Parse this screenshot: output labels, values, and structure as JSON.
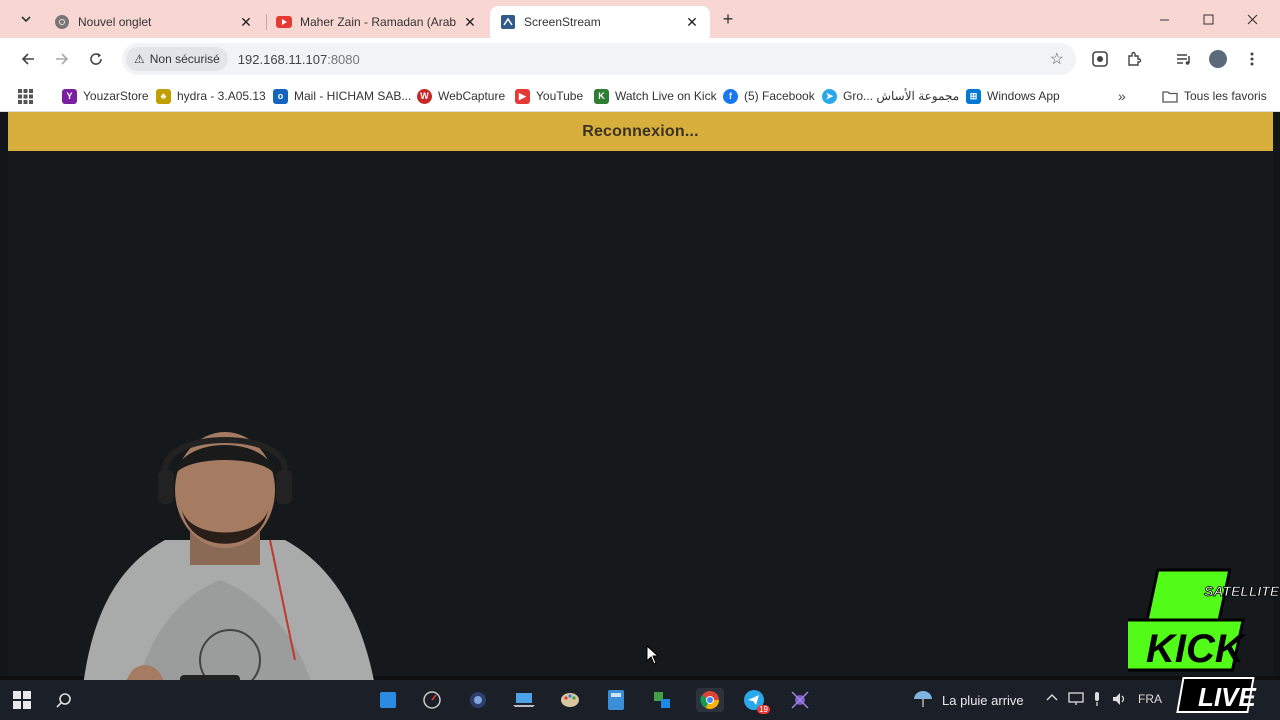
{
  "browser": {
    "tabs": [
      {
        "title": "Nouvel onglet",
        "icon": "chrome-icon",
        "active": false
      },
      {
        "title": "Maher Zain - Ramadan (Arabic)",
        "icon": "youtube-icon",
        "active": false
      },
      {
        "title": "ScreenStream",
        "icon": "screenstream-icon",
        "active": true
      }
    ],
    "security_label": "Non sécurisé",
    "url_host": "192.168.11.107",
    "url_port": ":8080",
    "bookmarks": [
      {
        "label": "YouzarStore",
        "icon": "yahoo-icon",
        "color": "#7b1fa2"
      },
      {
        "label": "hydra - 3.A05.13",
        "icon": "hydra-icon",
        "color": "#c0a000"
      },
      {
        "label": "Mail - HICHAM SAB...",
        "icon": "mail-icon",
        "color": "#1565c0"
      },
      {
        "label": "WebCapture",
        "icon": "webcapture-icon",
        "color": "#c62828"
      },
      {
        "label": "YouTube",
        "icon": "youtube-icon",
        "color": "#e53935"
      },
      {
        "label": "Watch Live on Kick",
        "icon": "kick-icon",
        "color": "#2e7d32"
      },
      {
        "label": "(5) Facebook",
        "icon": "facebook-icon",
        "color": "#1877f2"
      },
      {
        "label": "Gro... مجموعة الأساش",
        "icon": "telegram-icon",
        "color": "#29a9eb"
      },
      {
        "label": "Windows App",
        "icon": "windows-icon",
        "color": "#0078d4"
      }
    ],
    "all_bookmarks_label": "Tous les favoris"
  },
  "page": {
    "banner_text": "Reconnexion...",
    "banner_color": "#d8af3c",
    "background_color": "#15191b"
  },
  "taskbar": {
    "weather_text": "La pluie arrive",
    "language": "FRA",
    "chat_badge": "19"
  },
  "overlay": {
    "logo_top_text": "SATELLITE",
    "logo_brand": "KICK",
    "logo_bottom": "LIVE"
  }
}
